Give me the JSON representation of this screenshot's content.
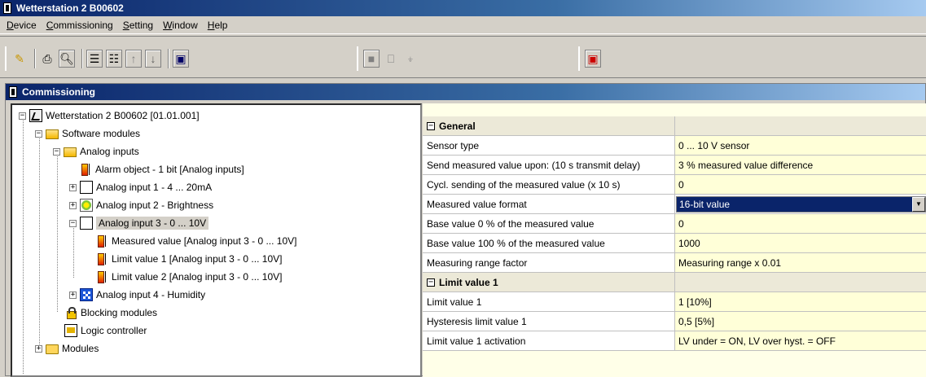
{
  "window": {
    "title": "Wetterstation 2 B00602"
  },
  "menu": [
    {
      "label": "Device",
      "u": "D",
      "rest": "evice"
    },
    {
      "label": "Commissioning",
      "u": "C",
      "rest": "ommissioning"
    },
    {
      "label": "Setting",
      "u": "S",
      "rest": "etting"
    },
    {
      "label": "Window",
      "u": "W",
      "rest": "indow"
    },
    {
      "label": "Help",
      "u": "H",
      "rest": "elp"
    }
  ],
  "child_window": {
    "title": "Commissioning"
  },
  "tree": {
    "root": "Wetterstation 2 B00602 [01.01.001]",
    "software_modules": "Software modules",
    "analog_inputs": "Analog inputs",
    "alarm_object": "Alarm object - 1 bit [Analog inputs]",
    "ai1": "Analog input 1 - 4 ... 20mA",
    "ai2": "Analog input 2 - Brightness",
    "ai3": "Analog input 3 - 0 ... 10V",
    "ai3_mv": "Measured value [Analog input 3 - 0 ... 10V]",
    "ai3_lv1": "Limit value 1 [Analog input 3 - 0 ... 10V]",
    "ai3_lv2": "Limit value 2 [Analog input 3 - 0 ... 10V]",
    "ai4": "Analog input 4 - Humidity",
    "blocking": "Blocking modules",
    "logic": "Logic controller",
    "modules": "Modules"
  },
  "properties": {
    "general_header": "General",
    "rows": [
      {
        "name": "Sensor type",
        "value": "0 ... 10 V sensor"
      },
      {
        "name": "Send measured value upon: (10 s transmit delay)",
        "value": "3 % measured value difference"
      },
      {
        "name": "Cycl. sending of the measured value (x 10 s)",
        "value": "0"
      },
      {
        "name": "Measured value format",
        "value": "16-bit value"
      },
      {
        "name": "Base value 0 % of the measured value",
        "value": "0"
      },
      {
        "name": "Base value 100 % of the measured value",
        "value": "1000"
      },
      {
        "name": "Measuring range factor",
        "value": "Measuring range x 0.01"
      }
    ],
    "limit1_header": "Limit value 1",
    "limit_rows": [
      {
        "name": "Limit value 1",
        "value": "1 [10%]"
      },
      {
        "name": "Hysteresis limit value 1",
        "value": "0,5 [5%]"
      },
      {
        "name": "Limit value 1 activation",
        "value": "LV under = ON, LV over hyst. = OFF"
      }
    ]
  }
}
